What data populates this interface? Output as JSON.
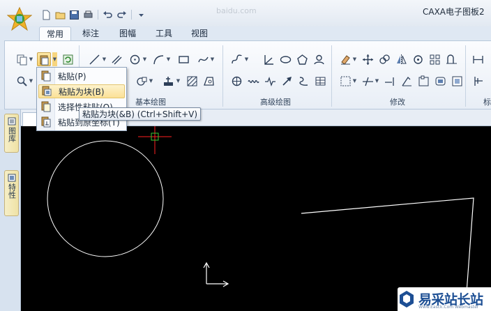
{
  "app": {
    "title": "CAXA电子图板2",
    "ghost_url": "baidu.com"
  },
  "quick_access": {
    "icons": [
      "new-file-icon",
      "open-folder-icon",
      "save-icon",
      "print-icon",
      "undo-icon",
      "redo-icon",
      "customize-icon"
    ]
  },
  "ribbon": {
    "tabs": [
      {
        "label": "常用",
        "active": true
      },
      {
        "label": "标注",
        "active": false
      },
      {
        "label": "图幅",
        "active": false
      },
      {
        "label": "工具",
        "active": false
      },
      {
        "label": "视图",
        "active": false
      }
    ],
    "groups": {
      "basic_draw": "基本绘图",
      "advanced_draw": "高级绘图",
      "modify": "修改",
      "truncated": "标"
    }
  },
  "paste_menu": {
    "items": [
      {
        "label": "粘贴(P)",
        "icon": "paste-icon"
      },
      {
        "label": "粘贴为块(B)",
        "icon": "paste-as-block-icon",
        "highlighted": true
      },
      {
        "label": "选择性粘贴(O)",
        "icon": "paste-special-icon"
      },
      {
        "label": "粘贴到原坐标(T)",
        "icon": "paste-to-original-icon"
      }
    ],
    "tooltip": "粘贴为块(&B) (Ctrl+Shift+V)"
  },
  "left_panel": {
    "tabs": [
      {
        "label": "图库",
        "icon": "library-icon"
      },
      {
        "label": "特性",
        "icon": "properties-icon"
      }
    ]
  },
  "canvas": {
    "background": "#000000",
    "stroke": "#ffffff",
    "cursor_color": "#ff2020",
    "cursor_box_color": "#33cc33"
  },
  "watermark": {
    "text": "易采站长站",
    "sub": "Www.Easck.Com Webmaster"
  },
  "colors": {
    "ribbon_bg": "#e8eef6",
    "highlight": "#fbe196",
    "accent_blue": "#1d4f94"
  }
}
